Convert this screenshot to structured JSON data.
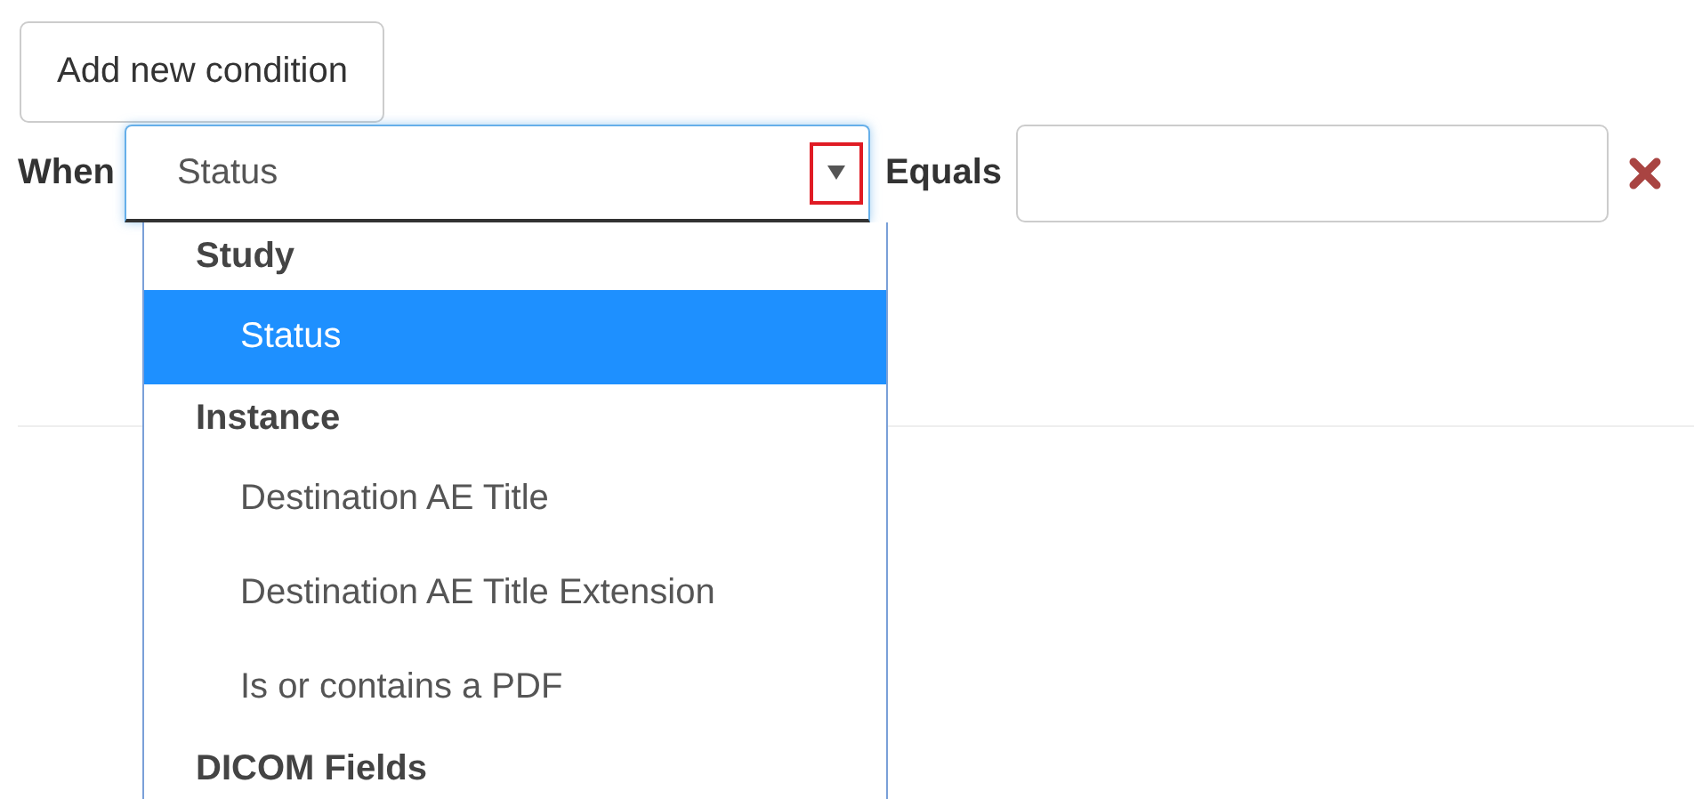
{
  "add_button": {
    "label": "Add new condition"
  },
  "condition": {
    "field_label": "When",
    "field_value": "Status",
    "operator_label": "Equals"
  },
  "dropdown": {
    "groups": [
      {
        "label": "Study",
        "options": [
          {
            "label": "Status",
            "selected": true
          }
        ]
      },
      {
        "label": "Instance",
        "options": [
          {
            "label": "Destination AE Title",
            "selected": false
          },
          {
            "label": "Destination AE Title Extension",
            "selected": false
          },
          {
            "label": "Is or contains a PDF",
            "selected": false
          }
        ]
      },
      {
        "label": "DICOM Fields"
      }
    ]
  }
}
